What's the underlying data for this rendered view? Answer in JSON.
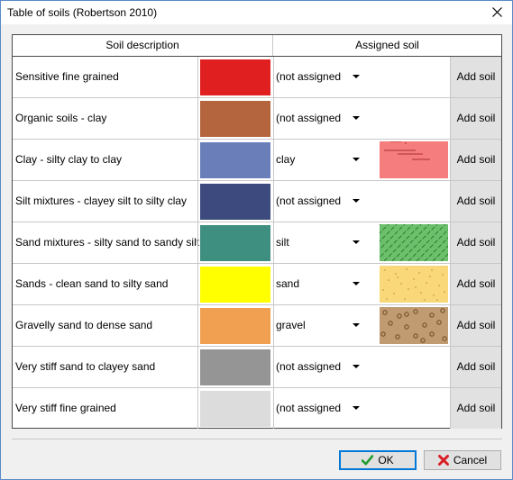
{
  "window": {
    "title": "Table of soils (Robertson 2010)"
  },
  "table": {
    "headers": {
      "description": "Soil description",
      "assigned": "Assigned soil"
    },
    "rows": [
      {
        "description": "Sensitive fine grained",
        "color": "#e02020",
        "assigned": "(not assigned",
        "pattern": "none",
        "add_label": "Add soil"
      },
      {
        "description": "Organic soils - clay",
        "color": "#b5653d",
        "assigned": "(not assigned",
        "pattern": "none",
        "add_label": "Add soil"
      },
      {
        "description": "Clay - silty clay to clay",
        "color": "#6a7fba",
        "assigned": "clay",
        "pattern": "clay",
        "add_label": "Add soil"
      },
      {
        "description": "Silt mixtures - clayey silt to silty clay",
        "color": "#3d4a7d",
        "assigned": "(not assigned",
        "pattern": "none",
        "add_label": "Add soil"
      },
      {
        "description": "Sand mixtures - silty sand to sandy silt",
        "color": "#3f8f80",
        "assigned": "silt",
        "pattern": "silt",
        "add_label": "Add soil"
      },
      {
        "description": "Sands - clean sand to silty sand",
        "color": "#ffff00",
        "assigned": "sand",
        "pattern": "sand",
        "add_label": "Add soil"
      },
      {
        "description": "Gravelly sand to dense sand",
        "color": "#f0a050",
        "assigned": "gravel",
        "pattern": "gravel",
        "add_label": "Add soil"
      },
      {
        "description": "Very stiff sand to clayey sand",
        "color": "#959595",
        "assigned": "(not assigned",
        "pattern": "none",
        "add_label": "Add soil"
      },
      {
        "description": "Very stiff fine grained",
        "color": "#dcdcdc",
        "assigned": "(not assigned",
        "pattern": "none",
        "add_label": "Add soil"
      }
    ]
  },
  "buttons": {
    "ok_label": "OK",
    "cancel_label": "Cancel"
  }
}
